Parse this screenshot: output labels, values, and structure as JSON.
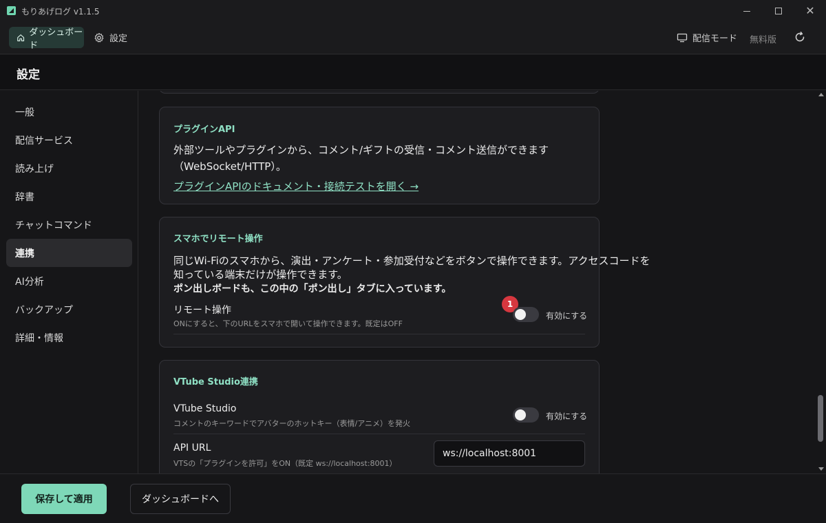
{
  "window": {
    "title": "もりあげログ  v1.1.5"
  },
  "nav": {
    "dashboard_label": "ダッシュボード",
    "settings_label": "設定",
    "stream_mode_label": "配信モード",
    "free_label": "無料版"
  },
  "page": {
    "title": "設定"
  },
  "sidebar": {
    "items": [
      {
        "label": "一般",
        "active": false
      },
      {
        "label": "配信サービス",
        "active": false
      },
      {
        "label": "読み上げ",
        "active": false
      },
      {
        "label": "辞書",
        "active": false
      },
      {
        "label": "チャットコマンド",
        "active": false
      },
      {
        "label": "連携",
        "active": true
      },
      {
        "label": "AI分析",
        "active": false
      },
      {
        "label": "バックアップ",
        "active": false
      },
      {
        "label": "詳細・情報",
        "active": false
      }
    ]
  },
  "cards": {
    "plugin": {
      "title": "プラグインAPI",
      "desc_line1": "外部ツールやプラグインから、コメント/ギフトの受信・コメント送信ができます",
      "desc_line2": "（WebSocket/HTTP）。",
      "link": "プラグインAPIのドキュメント・接続テストを開く →"
    },
    "remote": {
      "title": "スマホでリモート操作",
      "desc_line1": "同じWi-Fiのスマホから、演出・アンケート・参加受付などをボタンで操作できます。アクセスコードを",
      "desc_line2": "知っている端末だけが操作できます。",
      "desc_bold": "ポン出しボードも、この中の「ポン出し」タブに入っています。",
      "row_label": "リモート操作",
      "row_sub": "ONにすると、下のURLをスマホで開いて操作できます。既定はOFF",
      "toggle_label": "有効にする",
      "toggle_on": false,
      "badge": "1"
    },
    "vtube": {
      "title": "VTube Studio連携",
      "row_label": "VTube Studio",
      "row_sub": "コメントのキーワードでアバターのホットキー（表情/アニメ）を発火",
      "toggle_label": "有効にする",
      "toggle_on": false,
      "api_label": "API URL",
      "api_sub": "VTSの「プラグインを許可」をON（既定 ws://localhost:8001）",
      "api_value": "ws://localhost:8001"
    }
  },
  "footer": {
    "save_label": "保存して適用",
    "dashboard_label": "ダッシュボードへ"
  },
  "colors": {
    "accent": "#8fe0c4",
    "save_button": "#7ed8b8",
    "badge": "#d6373f"
  }
}
